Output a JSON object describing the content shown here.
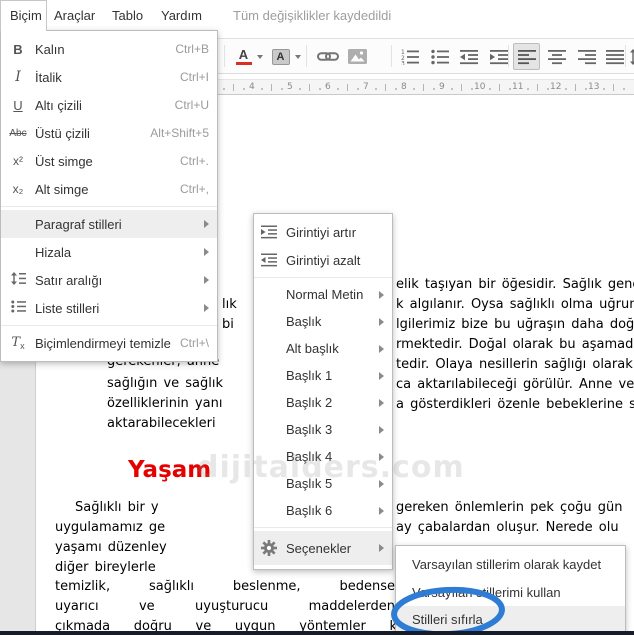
{
  "menubar": {
    "tab": "Biçim",
    "items": [
      "Araçlar",
      "Tablo",
      "Yardım"
    ],
    "status": "Tüm değişiklikler kaydedildi"
  },
  "icons": {
    "bold": "B",
    "italic": "I",
    "underline": "U",
    "strikethrough": "Abc",
    "superscript": "x²",
    "subscript": "x₂",
    "clear_t": "T",
    "clear_x": "x",
    "text_color": "A",
    "highlight": "A"
  },
  "ruler": {
    "numbers": [
      "4",
      "5",
      "6",
      "7",
      "8",
      "9",
      "10",
      "11",
      "12",
      "13"
    ]
  },
  "format_menu": {
    "items": [
      {
        "label": "Kalın",
        "shortcut": "Ctrl+B"
      },
      {
        "label": "İtalik",
        "shortcut": "Ctrl+I"
      },
      {
        "label": "Altı çizili",
        "shortcut": "Ctrl+U"
      },
      {
        "label": "Üstü çizili",
        "shortcut": "Alt+Shift+5"
      },
      {
        "label": "Üst simge",
        "shortcut": "Ctrl+."
      },
      {
        "label": "Alt simge",
        "shortcut": "Ctrl+,"
      },
      {
        "label": "Paragraf stilleri"
      },
      {
        "label": "Hizala"
      },
      {
        "label": "Satır aralığı"
      },
      {
        "label": "Liste stilleri"
      },
      {
        "label": "Biçimlendirmeyi temizle",
        "shortcut": "Ctrl+\\"
      }
    ]
  },
  "paragraph_styles_menu": {
    "items": [
      {
        "label": "Girintiyi artır"
      },
      {
        "label": "Girintiyi azalt"
      },
      {
        "label": "Normal Metin"
      },
      {
        "label": "Başlık"
      },
      {
        "label": "Alt başlık"
      },
      {
        "label": "Başlık 1"
      },
      {
        "label": "Başlık 2"
      },
      {
        "label": "Başlık 3"
      },
      {
        "label": "Başlık 4"
      },
      {
        "label": "Başlık 5"
      },
      {
        "label": "Başlık 6"
      },
      {
        "label": "Seçenekler"
      }
    ]
  },
  "options_menu": {
    "items": [
      "Varsayılan stillerim olarak kaydet",
      "Varsayılan stillerimi kullan",
      "Stilleri sıfırla"
    ]
  },
  "document": {
    "heading": "Yaşam",
    "watermark": "dijitalders.com",
    "fragments": [
      "lık",
      "bi",
      "elik taşıyan bir öğesidir. Sağlık gene",
      "k algılanır. Oysa sağlıklı olma uğrund",
      "lgilerimiz bize bu uğraşın daha doğ",
      "rmektedir. Doğal olarak bu aşamad",
      "tedir. Olaya nesillerin sağlığı olarak",
      "ca aktarılabileceği görülür. Anne ve",
      "a gösterdikleri özenle bebeklerine s",
      "gerekenler, anne",
      "sağlığın ve sağlık",
      "özelliklerinin yanı",
      "aktarabilecekleri",
      "Sağlıklı bir y",
      "uygulamamız ge",
      "yaşamı düzenley",
      "diğer bireylerle",
      "temizlik, sağlıklı beslenme, bedense",
      "uyarıcı ve uyuşturucu maddelerden",
      "çıkmada doğru ve uygun yöntemler k"
    ],
    "fragments_right": [
      "gereken önlemlerin pek çoğu gün",
      "ay çabalardan oluşur. Nerede olu"
    ]
  },
  "colors": {
    "annotation": "#2e7cd4",
    "heading": "#e60000",
    "text_color_underline": "#d93025",
    "highlight_row": "#eeeeee"
  }
}
